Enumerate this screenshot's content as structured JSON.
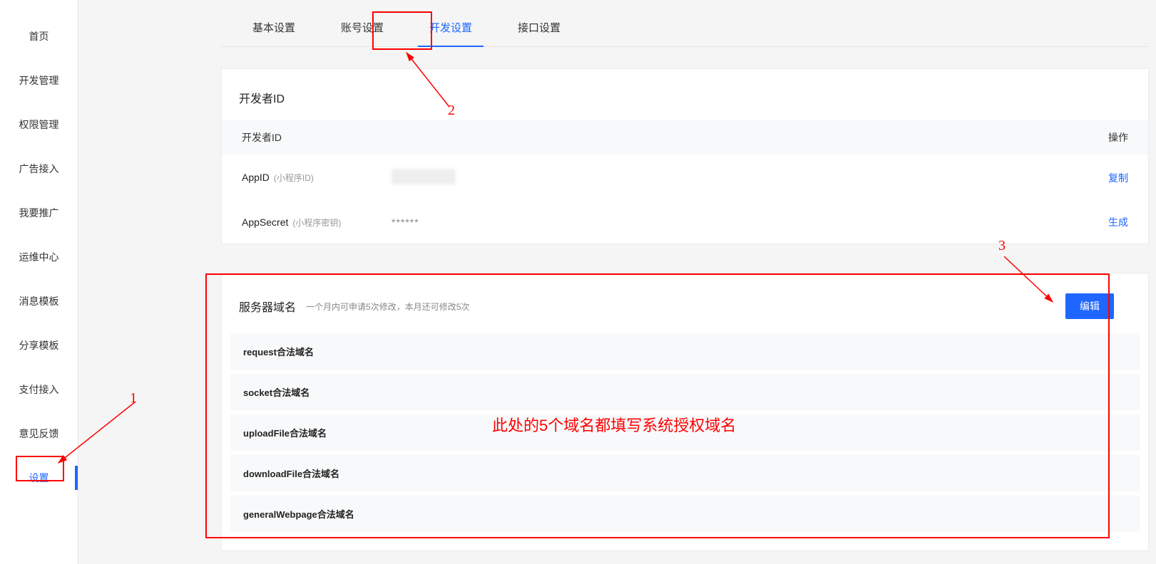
{
  "sidebar": {
    "items": [
      {
        "label": "首页"
      },
      {
        "label": "开发管理"
      },
      {
        "label": "权限管理"
      },
      {
        "label": "广告接入"
      },
      {
        "label": "我要推广"
      },
      {
        "label": "运维中心"
      },
      {
        "label": "消息模板"
      },
      {
        "label": "分享模板"
      },
      {
        "label": "支付接入"
      },
      {
        "label": "意见反馈"
      },
      {
        "label": "设置"
      }
    ],
    "active_index": 10
  },
  "tabs": {
    "items": [
      {
        "label": "基本设置"
      },
      {
        "label": "账号设置"
      },
      {
        "label": "开发设置"
      },
      {
        "label": "接口设置"
      }
    ],
    "active_index": 2
  },
  "dev_id_card": {
    "title": "开发者ID",
    "header_left": "开发者ID",
    "header_right": "操作",
    "rows": [
      {
        "label": "AppID",
        "sublabel": "(小程序ID)",
        "value": "",
        "action": "复制"
      },
      {
        "label": "AppSecret",
        "sublabel": "(小程序密钥)",
        "value": "******",
        "action": "生成"
      }
    ]
  },
  "domain_card": {
    "title": "服务器域名",
    "subtitle": "一个月内可申请5次修改，本月还可修改5次",
    "edit_label": "编辑",
    "rows": [
      {
        "label": "request合法域名"
      },
      {
        "label": "socket合法域名"
      },
      {
        "label": "uploadFile合法域名"
      },
      {
        "label": "downloadFile合法域名"
      },
      {
        "label": "generalWebpage合法域名"
      }
    ]
  },
  "annotations": {
    "n1": "1",
    "n2": "2",
    "n3": "3",
    "note": "此处的5个域名都填写系统授权域名"
  }
}
